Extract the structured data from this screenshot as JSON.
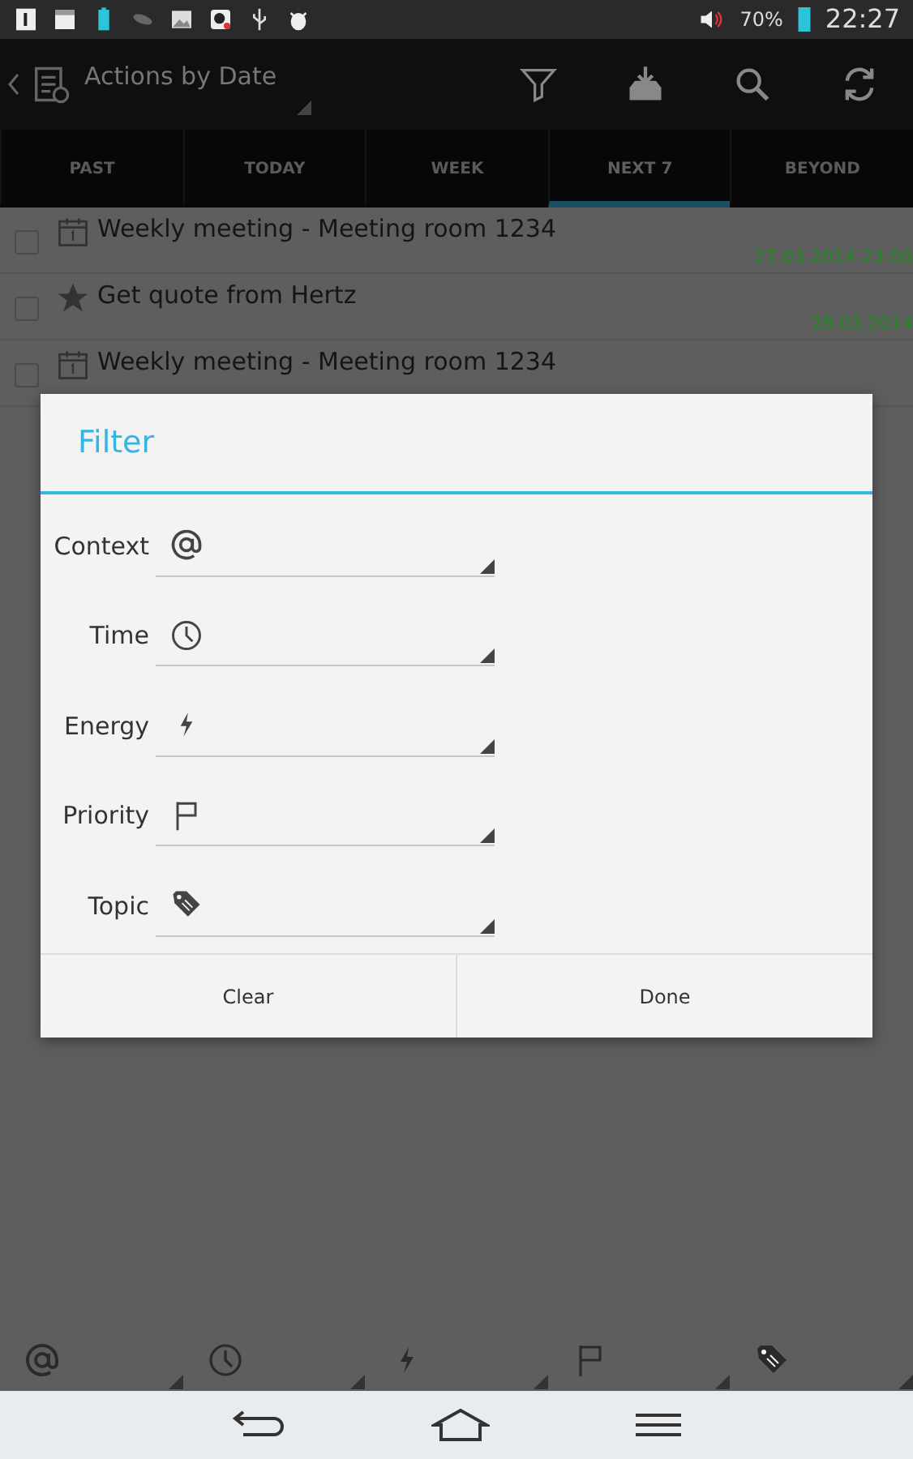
{
  "status_bar": {
    "battery": "70%",
    "time": "22:27"
  },
  "action_bar": {
    "title": "Actions by Date"
  },
  "tabs": [
    {
      "label": "PAST",
      "selected": false
    },
    {
      "label": "TODAY",
      "selected": false
    },
    {
      "label": "WEEK",
      "selected": false
    },
    {
      "label": "NEXT 7",
      "selected": true
    },
    {
      "label": "BEYOND",
      "selected": false
    }
  ],
  "tasks": [
    {
      "kind": "event",
      "title": "Weekly meeting - Meeting room 1234",
      "due": "27.03.2014 23:00",
      "checked": false
    },
    {
      "kind": "starred",
      "title": "Get quote from Hertz",
      "due": "28.03.2014",
      "checked": false
    },
    {
      "kind": "event",
      "title": "Weekly meeting - Meeting room 1234",
      "checked": false
    }
  ],
  "dialog": {
    "title": "Filter",
    "fields": [
      {
        "kind": "context",
        "label": "Context"
      },
      {
        "kind": "time",
        "label": "Time"
      },
      {
        "kind": "energy",
        "label": "Energy"
      },
      {
        "kind": "priority",
        "label": "Priority"
      },
      {
        "kind": "topic",
        "label": "Topic"
      }
    ],
    "buttons": [
      "Clear",
      "Done"
    ]
  },
  "bottom_filters": [
    {
      "kind": "context"
    },
    {
      "kind": "time"
    },
    {
      "kind": "energy"
    },
    {
      "kind": "priority"
    },
    {
      "kind": "topic"
    }
  ]
}
